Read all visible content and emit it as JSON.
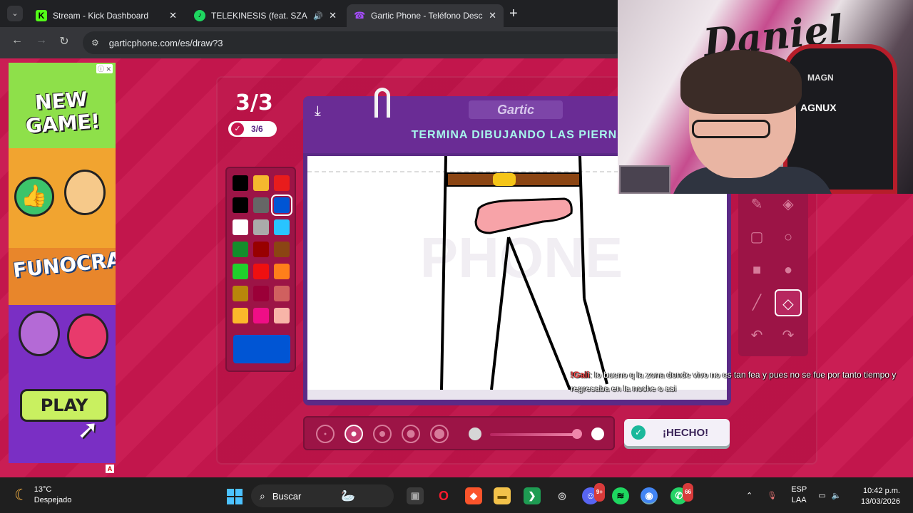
{
  "browser": {
    "tabs": [
      {
        "title": "Stream - Kick Dashboard",
        "favicon_color": "#53fc18",
        "favicon_letter": "K"
      },
      {
        "title": "TELEKINESIS (feat. SZA & Fu",
        "favicon_color": "#1ed760",
        "favicon_letter": "♪"
      },
      {
        "title": "Gartic Phone - Teléfono Descon",
        "favicon_color": "#a64dff",
        "favicon_letter": "☎"
      }
    ],
    "url": "garticphone.com/es/draw?3"
  },
  "ad": {
    "title": "NEW GAME!",
    "brand": "FUNOCRACY",
    "play_label": "PLAY",
    "info_icon": "ⓘ ✕",
    "choice_label": "A"
  },
  "game": {
    "round": "3/3",
    "progress": "3/6",
    "logo": "Gartic",
    "prompt": "TERMINA DIBUJANDO LAS PIERNAS",
    "done_label": "¡HECHO!",
    "palette": [
      "#000000",
      "#f5b82e",
      "#e81c1c",
      "#000000",
      "#666666",
      "#0055d4",
      "#ffffff",
      "#aaaaaa",
      "#29c4ff",
      "#148d2b",
      "#980000",
      "#8b4513",
      "#1fd02b",
      "#ef1010",
      "#ff7f1a",
      "#b8860b",
      "#9b0038",
      "#d0605f",
      "#fbb92b",
      "#ef0e86",
      "#f8b5a8"
    ],
    "selected_color": "#0055d4",
    "brush_sizes": 5,
    "selected_brush": 2,
    "opacity_level": 0.8
  },
  "tools": [
    "pencil-icon",
    "eraser-icon",
    "rectangle-icon",
    "ellipse-icon",
    "filled-rectangle-icon",
    "filled-ellipse-icon",
    "line-icon",
    "fill-bucket-icon",
    "undo-icon",
    "redo-icon"
  ],
  "webcam": {
    "graffiti": "Daniel",
    "chair_brand": "AGNUX",
    "chair_top": "MAGN"
  },
  "chat": {
    "user": "!Gali",
    "message": ": lo bueno q la zona donde vivo no es tan fea y pues no se fue por tanto tiempo y regresaba en la noche o asi"
  },
  "taskbar": {
    "temperature": "13°C",
    "weather": "Despejado",
    "search_placeholder": "Buscar",
    "language": "ESP",
    "layout": "LAA",
    "time": "10:42 p.m.",
    "date": "13/03/2026",
    "discord_badge": "9+",
    "whatsapp_badge": "66"
  }
}
